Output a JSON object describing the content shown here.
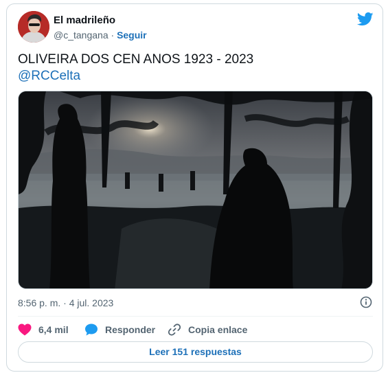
{
  "author": {
    "display_name": "El madrileño",
    "handle": "@c_tangana",
    "separator": "·",
    "follow_label": "Seguir"
  },
  "tweet": {
    "text": "OLIVEIRA DOS CEN ANOS 1923 - 2023",
    "mention": "@RCCelta",
    "timestamp": "8:56 p. m. · 4 jul. 2023"
  },
  "actions": {
    "like_count": "6,4 mil",
    "reply_label": "Responder",
    "copy_label": "Copia enlace"
  },
  "read_replies_label": "Leer 151 respuestas",
  "icons": {
    "brand": "twitter-bird-icon",
    "info": "info-icon",
    "like": "heart-icon",
    "reply": "speech-bubble-icon",
    "copy": "link-icon"
  },
  "colors": {
    "brand_blue": "#1d9bf0",
    "link_blue": "#1d70b8",
    "like_pink": "#f91880",
    "muted_text": "#536471",
    "border": "#cfd9de"
  }
}
